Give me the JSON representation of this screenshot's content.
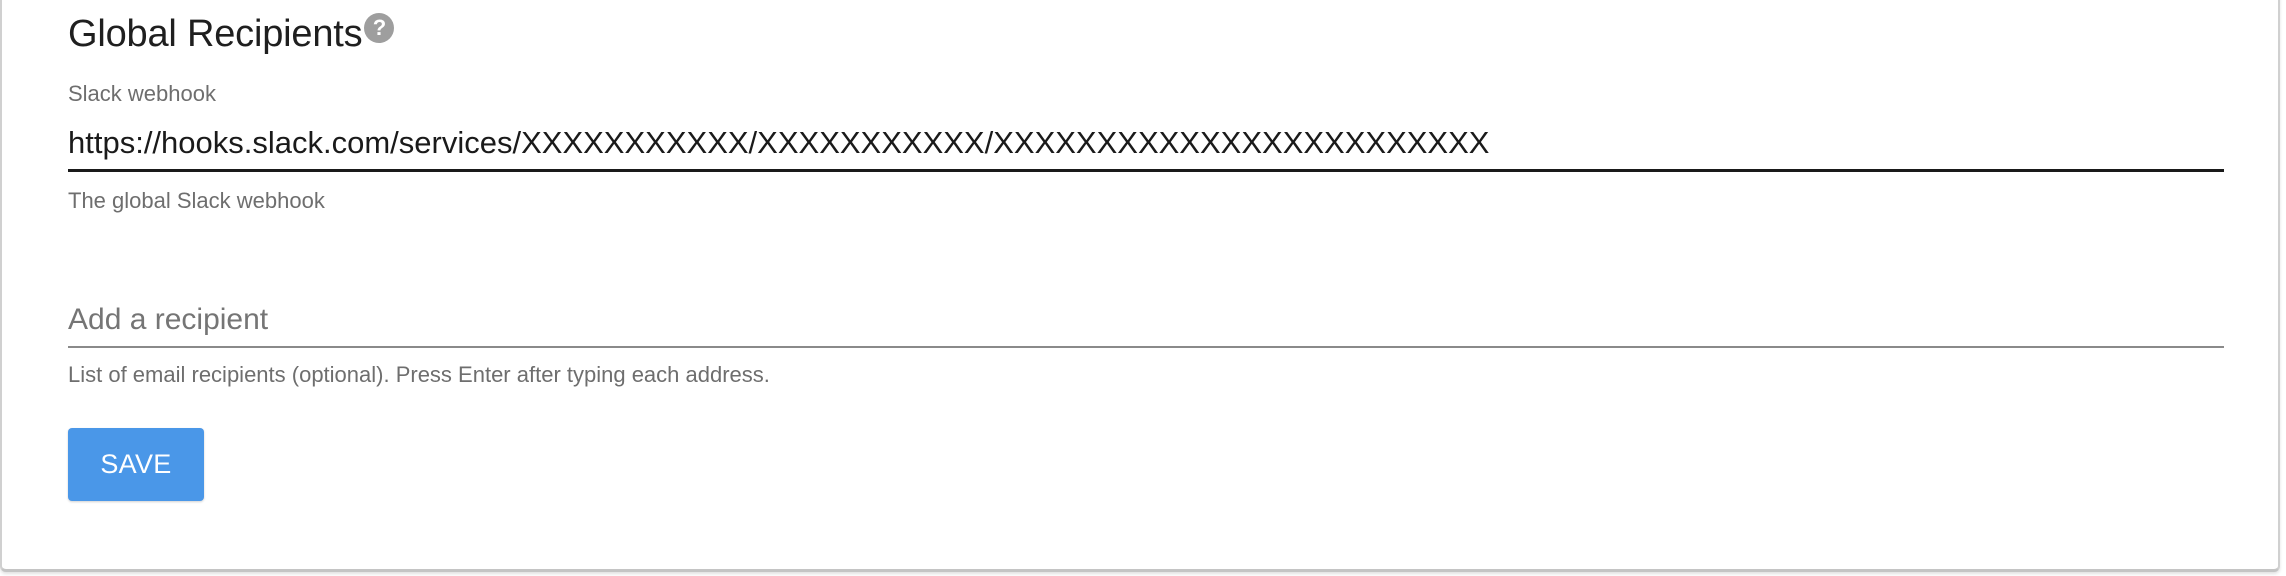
{
  "section": {
    "title": "Global Recipients",
    "help_icon": "help-circle-icon"
  },
  "slack_webhook": {
    "label": "Slack webhook",
    "value": "https://hooks.slack.com/services/XXXXXXXXXXX/XXXXXXXXXXX/XXXXXXXXXXXXXXXXXXXXXXXX",
    "helper_text": "The global Slack webhook"
  },
  "recipients": {
    "placeholder": "Add a recipient",
    "helper_text": "List of email recipients (optional). Press Enter after typing each address."
  },
  "actions": {
    "save_label": "SAVE"
  },
  "colors": {
    "primary_button": "#4a97e8",
    "text_primary": "#1f1f1f",
    "text_secondary": "#6e6e6e"
  }
}
